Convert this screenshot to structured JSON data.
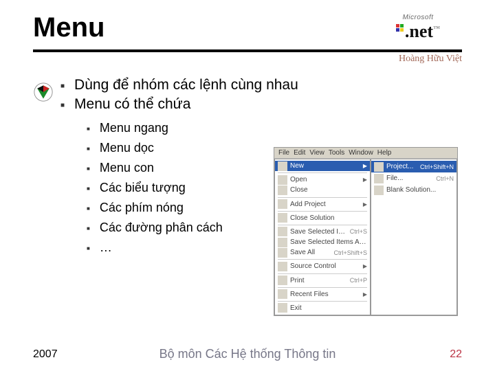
{
  "header": {
    "title": "Menu",
    "logo": {
      "microsoft": "Microsoft",
      "dotnet": ".net"
    },
    "author": "Hoàng Hữu Việt"
  },
  "bullets_level1": [
    "Dùng để nhóm các lệnh cùng nhau",
    "Menu có thể chứa"
  ],
  "bullets_level2": [
    "Menu ngang",
    "Menu dọc",
    "Menu con",
    "Các biểu tượng",
    "Các phím nóng",
    "Các đường phân cách",
    "…"
  ],
  "menu_shot": {
    "menubar": [
      "File",
      "Edit",
      "View",
      "Tools",
      "Window",
      "Help"
    ],
    "left_col": [
      {
        "label": "New",
        "shortcut": "",
        "arrow": true,
        "highlight": true
      },
      {
        "sep": true
      },
      {
        "label": "Open",
        "arrow": true
      },
      {
        "label": "Close"
      },
      {
        "sep": true
      },
      {
        "label": "Add Project",
        "arrow": true
      },
      {
        "sep": true
      },
      {
        "label": "Close Solution"
      },
      {
        "sep": true
      },
      {
        "label": "Save Selected Items",
        "shortcut": "Ctrl+S"
      },
      {
        "label": "Save Selected Items As..."
      },
      {
        "label": "Save All",
        "shortcut": "Ctrl+Shift+S"
      },
      {
        "sep": true
      },
      {
        "label": "Source Control",
        "arrow": true
      },
      {
        "sep": true
      },
      {
        "label": "Print",
        "shortcut": "Ctrl+P"
      },
      {
        "sep": true
      },
      {
        "label": "Recent Files",
        "arrow": true
      },
      {
        "sep": true
      },
      {
        "label": "Exit"
      }
    ],
    "right_col": [
      {
        "label": "Project...",
        "shortcut": "Ctrl+Shift+N",
        "highlight": true
      },
      {
        "label": "File...",
        "shortcut": "Ctrl+N"
      },
      {
        "label": "Blank Solution..."
      }
    ]
  },
  "footer": {
    "year": "2007",
    "dept": "Bộ môn Các Hệ thống Thông tin",
    "page": "22"
  }
}
